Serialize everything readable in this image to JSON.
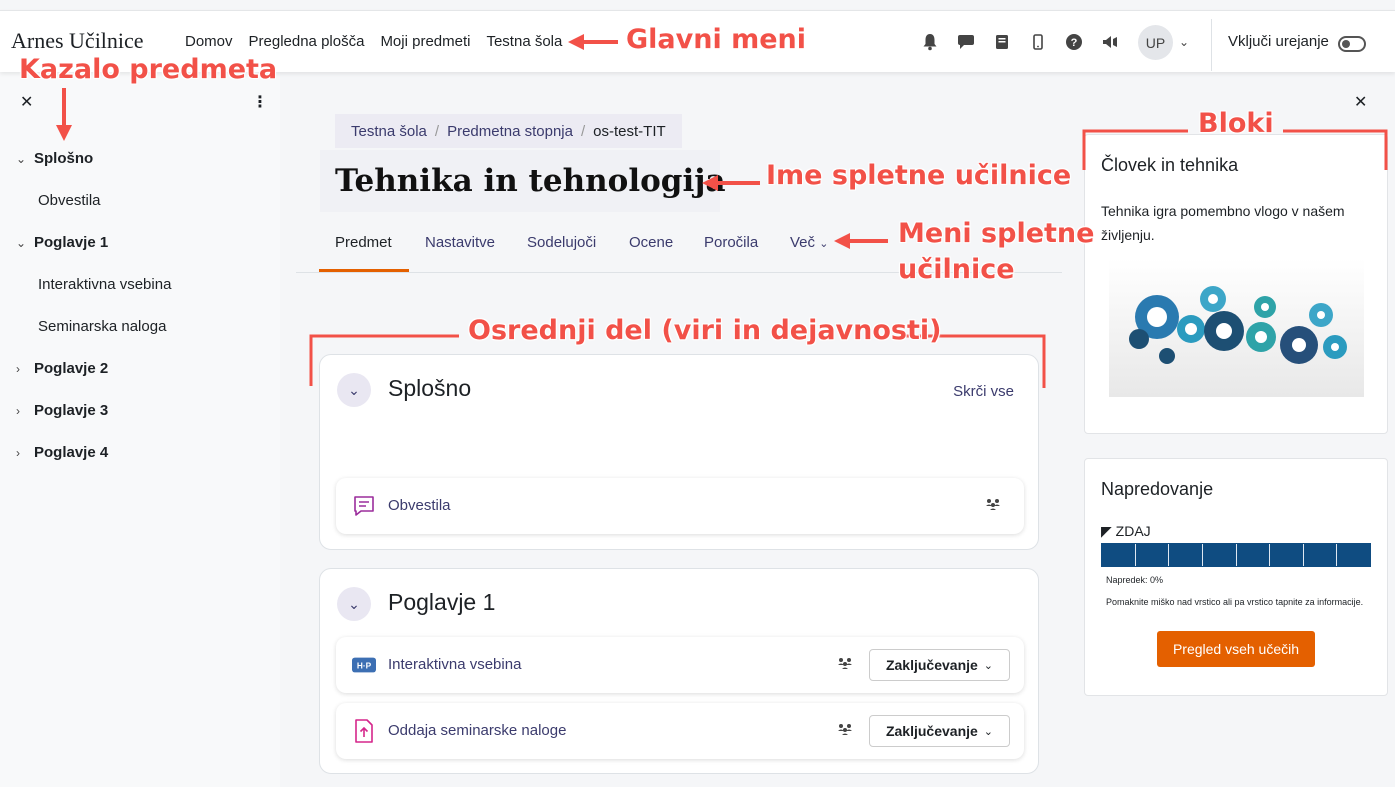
{
  "brand": "Arnes Učilnice",
  "nav": [
    "Domov",
    "Pregledna plošča",
    "Moji predmeti",
    "Testna šola"
  ],
  "user_initials": "UP",
  "edit_mode_label": "Vključi urejanje",
  "drawer": {
    "items": [
      {
        "label": "Splošno",
        "type": "section"
      },
      {
        "label": "Obvestila",
        "type": "activity"
      },
      {
        "label": "Poglavje 1",
        "type": "section"
      },
      {
        "label": "Interaktivna vsebina",
        "type": "activity"
      },
      {
        "label": "Seminarska naloga",
        "type": "activity"
      },
      {
        "label": "Poglavje 2",
        "type": "section"
      },
      {
        "label": "Poglavje 3",
        "type": "section"
      },
      {
        "label": "Poglavje 4",
        "type": "section"
      }
    ]
  },
  "breadcrumb": [
    "Testna šola",
    "Predmetna stopnja",
    "os-test-TIT"
  ],
  "course_title": "Tehnika in tehnologija",
  "tabs": [
    "Predmet",
    "Nastavitve",
    "Sodelujoči",
    "Ocene",
    "Poročila",
    "Več"
  ],
  "sections": [
    {
      "title": "Splošno",
      "collapse_all": "Skrči vse",
      "activities": [
        {
          "name": "Obvestila"
        }
      ]
    },
    {
      "title": "Poglavje 1",
      "activities": [
        {
          "name": "Interaktivna vsebina",
          "completion": "Zaključevanje"
        },
        {
          "name": "Oddaja seminarske naloge",
          "completion": "Zaključevanje"
        }
      ]
    }
  ],
  "blocks": {
    "b1_title": "Človek in tehnika",
    "b1_text": "Tehnika igra pomembno vlogo v našem življenju.",
    "b2_title": "Napredovanje",
    "b2_now": "ZDAJ",
    "b2_progress": "Napredek: 0%",
    "b2_hint": "Pomaknite miško nad vrstico ali pa vrstico tapnite za informacije.",
    "b2_button": "Pregled vseh učečih",
    "progress_fraction": 0
  },
  "annotations": {
    "main_menu": "Glavni meni",
    "course_index": "Kazalo predmeta",
    "course_name": "Ime spletne učilnice",
    "course_menu_1": "Meni spletne",
    "course_menu_2": "učilnice",
    "main_content": "Osrednji del (viri in dejavnosti)",
    "blocks": "Bloki"
  },
  "colors": {
    "accent": "#e46000",
    "annotation": "#f25148",
    "progress": "#0f4c81"
  }
}
